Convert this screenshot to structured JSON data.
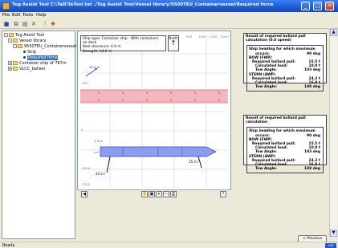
{
  "window": {
    "title": "Tug Assist Tool C:\\TaD\\TaTool.tat  ./Tug Assist Tool/Vessel library/9500TEU_Containervessel/Required force",
    "minimize": "_",
    "maximize": "□",
    "close": "✕"
  },
  "menu": [
    "File",
    "Edit",
    "Tools",
    "Help"
  ],
  "toolbar": [
    "save-icon",
    "copy-icon",
    "paste-icon",
    "delete-icon",
    "help-icon",
    "settings-icon"
  ],
  "tree": {
    "items": [
      {
        "label": "Tug Assist Tool",
        "expander": "-",
        "level": 0
      },
      {
        "label": "Vessel library",
        "expander": "-",
        "level": 1
      },
      {
        "label": "9500TEU_Containervessel",
        "expander": "-",
        "level": 2
      },
      {
        "label": "Ship",
        "level": 3
      },
      {
        "label": "Required force",
        "level": 3,
        "selected": true
      },
      {
        "label": "Container ship of 787m",
        "expander": "+",
        "level": 1
      },
      {
        "label": "VLCC_ballast",
        "expander": "+",
        "level": 1
      }
    ]
  },
  "center": {
    "info": {
      "line1": "Ship type: Container ship - With containers on deck",
      "line2": "Keel clearance: 4.0 m",
      "line3": "Draught: 14.0 m"
    },
    "north": "North",
    "axis_top": [
      "500",
      "1000",
      "1500",
      "2000"
    ],
    "axis_left": [
      "-500",
      "0",
      "-2000",
      "-2500"
    ],
    "labels": {
      "top_vector": "90.0 m",
      "bow_label": "1.0 m",
      "stern_load": "24.2 t",
      "bow_load": "15.5 t"
    }
  },
  "result1": {
    "title": "Result of required bollard pull calculation (0.0 speed)",
    "rows": [
      {
        "label": "Ship heading for which maximum",
        "value": "",
        "style": "b"
      },
      {
        "label": "occurs:",
        "value": "90 deg",
        "style": "b i2"
      },
      {
        "label": "BOW (FWP)",
        "value": "",
        "style": "b"
      },
      {
        "label": "Required bollard pull:",
        "value": "15.5 t",
        "style": "b i1"
      },
      {
        "label": "Calculated load:",
        "value": "10.0 t",
        "style": "b i2"
      },
      {
        "label": "Tow Angle:",
        "value": "193 deg",
        "style": "b i2"
      },
      {
        "label": "STERN (AWP)",
        "value": "",
        "style": "b"
      },
      {
        "label": "Required bollard pull:",
        "value": "24.2 t",
        "style": "b i1"
      },
      {
        "label": "Calculated load:",
        "value": "16.9 t",
        "style": "b i2"
      },
      {
        "label": "Tow Angle:",
        "value": "188 deg",
        "style": "b i2"
      }
    ]
  },
  "result2": {
    "title": "Result of required bollard pull calculation",
    "rows": [
      {
        "label": "Ship heading for which maximum",
        "value": "",
        "style": "b"
      },
      {
        "label": "occurs:",
        "value": "90 deg",
        "style": "b i2"
      },
      {
        "label": "BOW (FWP)",
        "value": "",
        "style": "b"
      },
      {
        "label": "Required bollard pull:",
        "value": "15.5 t",
        "style": "b i1"
      },
      {
        "label": "Calculated load:",
        "value": "10.0 t",
        "style": "b i2"
      },
      {
        "label": "Tow Angle:",
        "value": "193 deg",
        "style": "b i2"
      },
      {
        "label": "STERN (AWP)",
        "value": "",
        "style": "b"
      },
      {
        "label": "Required bollard pull:",
        "value": "24.2 t",
        "style": "b i1"
      },
      {
        "label": "Calculated load:",
        "value": "16.9 t",
        "style": "b i2"
      },
      {
        "label": "Tow Angle:",
        "value": "188 deg",
        "style": "b i2"
      }
    ]
  },
  "buttons": {
    "previous": "< Previous",
    "help": "?"
  },
  "status": {
    "text": "Ready",
    "indicator": "CAP"
  },
  "colors": {
    "ship": "#8C9CF0",
    "danger_band": "#F4B9BE",
    "titlebar": "#1C5BD6"
  }
}
